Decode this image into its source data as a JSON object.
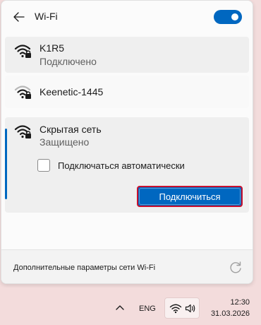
{
  "header": {
    "title": "Wi-Fi",
    "wifi_enabled": true
  },
  "networks": [
    {
      "name": "K1R5",
      "status": "Подключено",
      "secured": true,
      "signal": "strong",
      "icon": "wifi-lock-icon"
    },
    {
      "name": "Keenetic-1445",
      "status": "",
      "secured": true,
      "signal": "medium",
      "icon": "wifi-lock-icon"
    },
    {
      "name": "Скрытая сеть",
      "status": "Защищено",
      "secured": true,
      "signal": "strong",
      "icon": "wifi-lock-icon",
      "expanded": true,
      "auto_connect_label": "Подключаться автоматически",
      "auto_connect_checked": false,
      "connect_label": "Подключиться"
    }
  ],
  "footer": {
    "link_label": "Дополнительные параметры сети Wi-Fi",
    "refresh_icon": "refresh-icon"
  },
  "taskbar": {
    "language": "ENG",
    "time": "12:30",
    "date": "31.03.2026",
    "tray_icons": [
      "chevron-up-icon",
      "wifi-icon",
      "volume-icon"
    ]
  },
  "colors": {
    "accent": "#0067c0",
    "highlight_border": "#c8102e",
    "taskbar_bg": "#f3dcdc"
  }
}
